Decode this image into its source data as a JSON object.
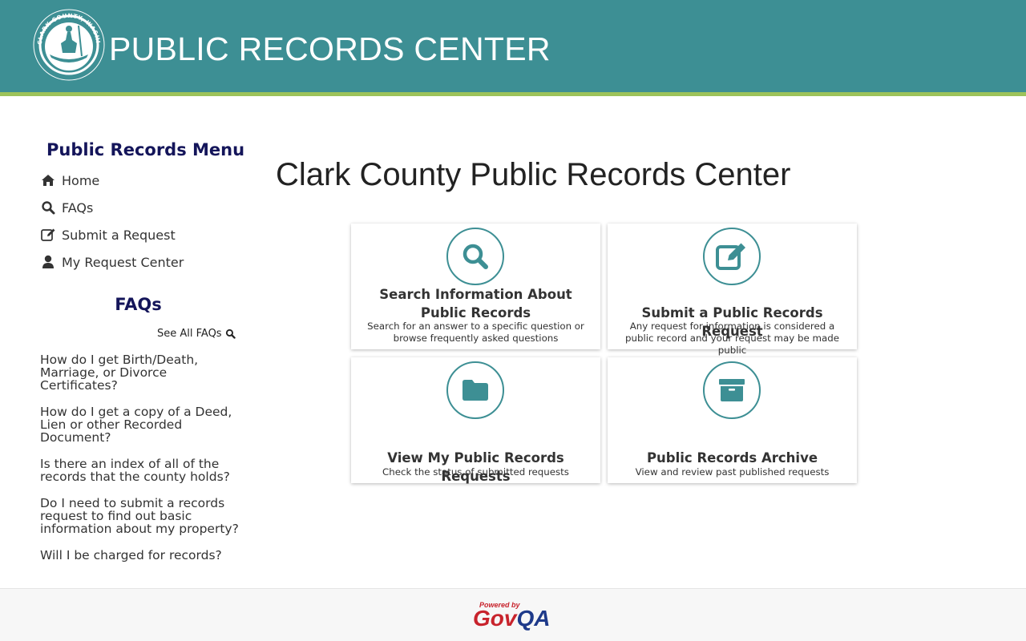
{
  "header": {
    "title": "PUBLIC RECORDS CENTER",
    "logo_text": "CLARK COUNTY, WASHINGTON",
    "logo_icon": "county-seal-icon",
    "bg_color": "#3d8f94",
    "stripe_color": "#9dc35a"
  },
  "sidebar": {
    "menu_title": "Public Records Menu",
    "menu": [
      {
        "label": "Home",
        "icon": "home-icon"
      },
      {
        "label": "FAQs",
        "icon": "search-icon"
      },
      {
        "label": "Submit a Request",
        "icon": "edit-icon"
      },
      {
        "label": "My Request Center",
        "icon": "user-icon"
      }
    ],
    "faq_title": "FAQs",
    "see_all": "See All FAQs",
    "faqs": [
      "How do I get Birth/Death, Marriage, or Divorce Certificates?",
      "How do I get a copy of a Deed, Lien or other Recorded Document?",
      "Is there an index of all of the records that the county holds?",
      "Do I need to submit a records request to find out basic information about my property?",
      "Will I be charged for records?"
    ]
  },
  "main": {
    "title": "Clark County Public Records Center",
    "cards": [
      {
        "title": "Search Information About Public Records",
        "desc": "Search for an answer to a specific question or browse frequently asked questions",
        "icon": "search-icon"
      },
      {
        "title": "Submit a Public Records Request",
        "desc": "Any request for information is considered a public record and your request may be made public",
        "icon": "edit-icon"
      },
      {
        "title": "View My Public Records Requests",
        "desc": "Check the status of submitted requests",
        "icon": "folder-icon"
      },
      {
        "title": "Public Records Archive",
        "desc": "View and review past published requests",
        "icon": "archive-icon"
      }
    ]
  },
  "footer": {
    "powered_by": "Powered by",
    "brand_part1": "Gov",
    "brand_part2": "QA"
  },
  "colors": {
    "accent": "#3d8f94",
    "heading": "#14155a",
    "brand_red": "#c8232c",
    "brand_blue": "#1e3a8a"
  }
}
